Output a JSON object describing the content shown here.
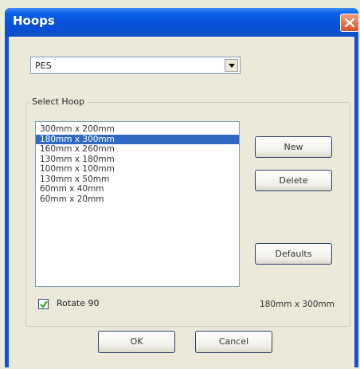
{
  "window": {
    "title": "Hoops"
  },
  "format_select": {
    "value": "PES"
  },
  "hoop_group": {
    "label": "Select Hoop",
    "items": [
      "300mm x 200mm",
      "180mm x 300mm",
      "160mm x 260mm",
      "130mm x 180mm",
      "100mm x 100mm",
      "130mm x 50mm",
      "60mm x 40mm",
      "60mm x 20mm"
    ],
    "selected_index": 1
  },
  "buttons": {
    "new": "New",
    "delete": "Delete",
    "defaults": "Defaults",
    "ok": "OK",
    "cancel": "Cancel"
  },
  "rotate": {
    "label": "Rotate 90",
    "checked": true
  },
  "selected_size": "180mm x 300mm",
  "icons": {
    "close": "close-icon",
    "dropdown": "chevron-down-icon",
    "check": "check-icon"
  }
}
